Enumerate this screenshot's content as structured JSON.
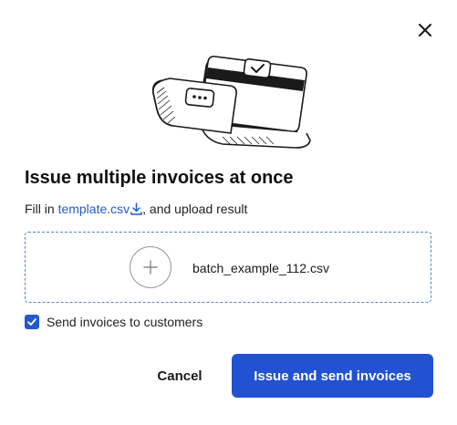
{
  "dialog": {
    "close_icon": "close-icon",
    "illustration": "card-payment-illustration",
    "title": "Issue multiple invoices at once",
    "instructions": {
      "prefix": "Fill in ",
      "link_text": "template.csv",
      "link_icon": "download-icon",
      "suffix": ", and upload result"
    },
    "upload": {
      "add_icon": "plus-icon",
      "filename": "batch_example_112.csv"
    },
    "checkbox": {
      "checked": true,
      "label": "Send invoices to customers"
    },
    "actions": {
      "cancel_label": "Cancel",
      "primary_label": "Issue and send invoices"
    }
  },
  "colors": {
    "accent": "#2252d1",
    "link": "#2459d3",
    "dropzone_border": "#5b7fd1"
  }
}
